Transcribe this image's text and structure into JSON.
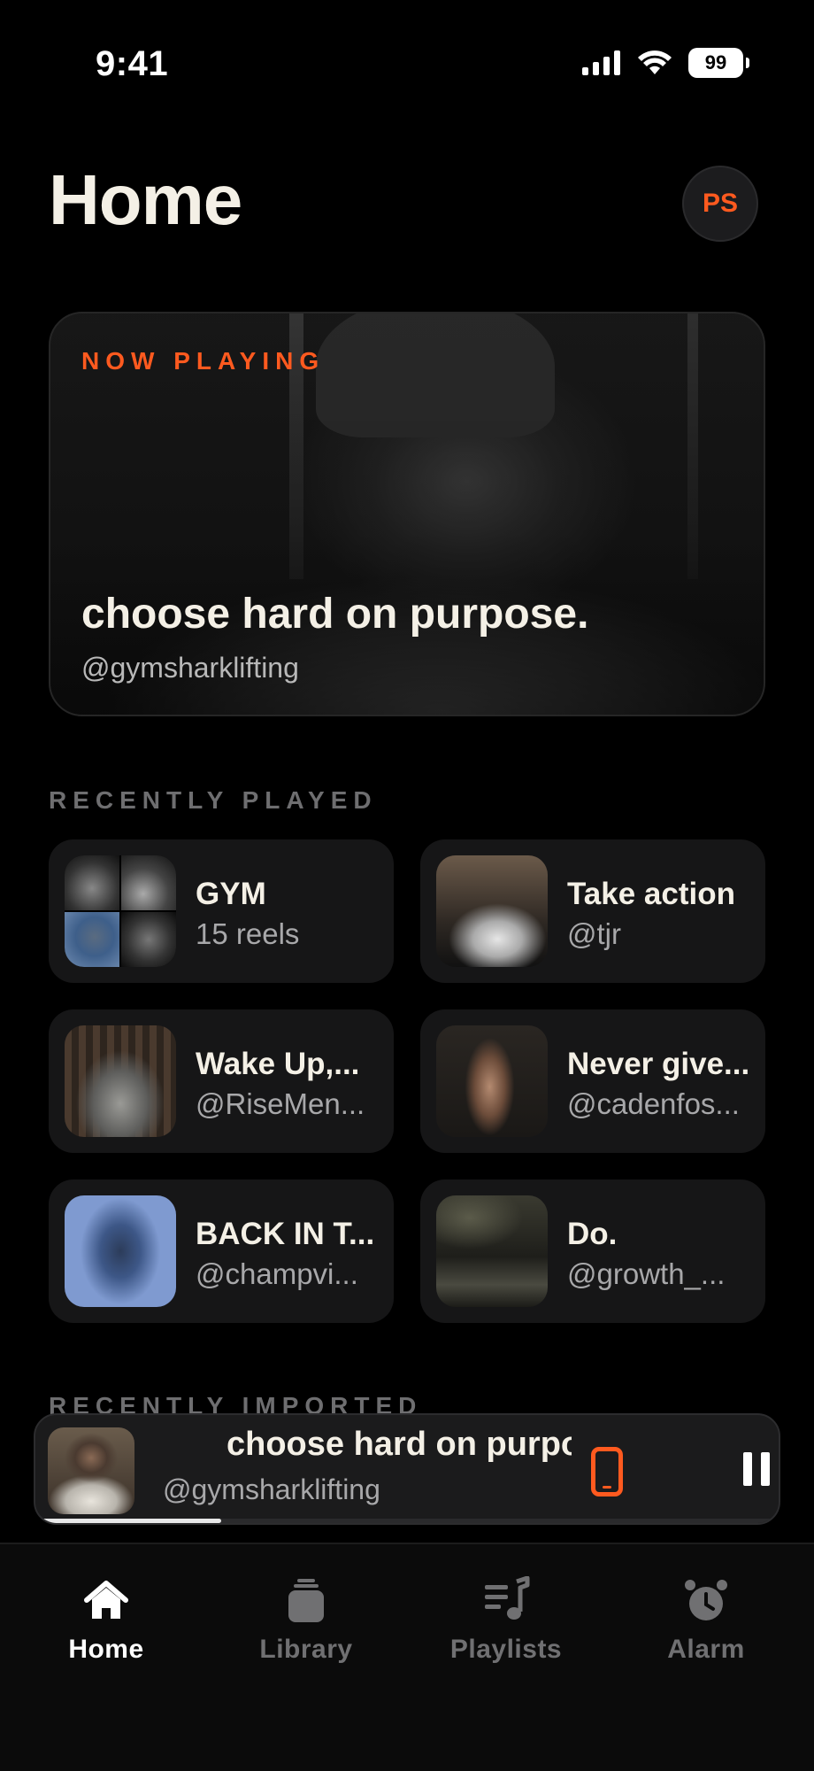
{
  "status_bar": {
    "time": "9:41",
    "battery": "99"
  },
  "header": {
    "title": "Home",
    "avatar_initials": "PS"
  },
  "now_playing": {
    "label": "NOW PLAYING",
    "title": "choose hard on purpose.",
    "handle": "@gymsharklifting"
  },
  "recently_played": {
    "label": "RECENTLY PLAYED",
    "items": [
      {
        "title": "GYM",
        "subtitle": "15 reels"
      },
      {
        "title": "Take action",
        "subtitle": "@tjr"
      },
      {
        "title": "Wake Up,...",
        "subtitle": "@RiseMen..."
      },
      {
        "title": "Never give...",
        "subtitle": "@cadenfos..."
      },
      {
        "title": "BACK IN T...",
        "subtitle": "@champvi..."
      },
      {
        "title": "Do.",
        "subtitle": "@growth_..."
      }
    ]
  },
  "recently_imported": {
    "label": "RECENTLY IMPORTED"
  },
  "mini_player": {
    "title": "choose hard on purpose.",
    "handle": "@gymsharklifting",
    "progress": 0.25
  },
  "tabs": [
    {
      "label": "Home",
      "icon": "home-icon",
      "active": true
    },
    {
      "label": "Library",
      "icon": "library-icon",
      "active": false
    },
    {
      "label": "Playlists",
      "icon": "playlists-icon",
      "active": false
    },
    {
      "label": "Alarm",
      "icon": "alarm-icon",
      "active": false
    }
  ],
  "colors": {
    "accent": "#ff5a1f",
    "background": "#000000",
    "tile": "#161617"
  }
}
